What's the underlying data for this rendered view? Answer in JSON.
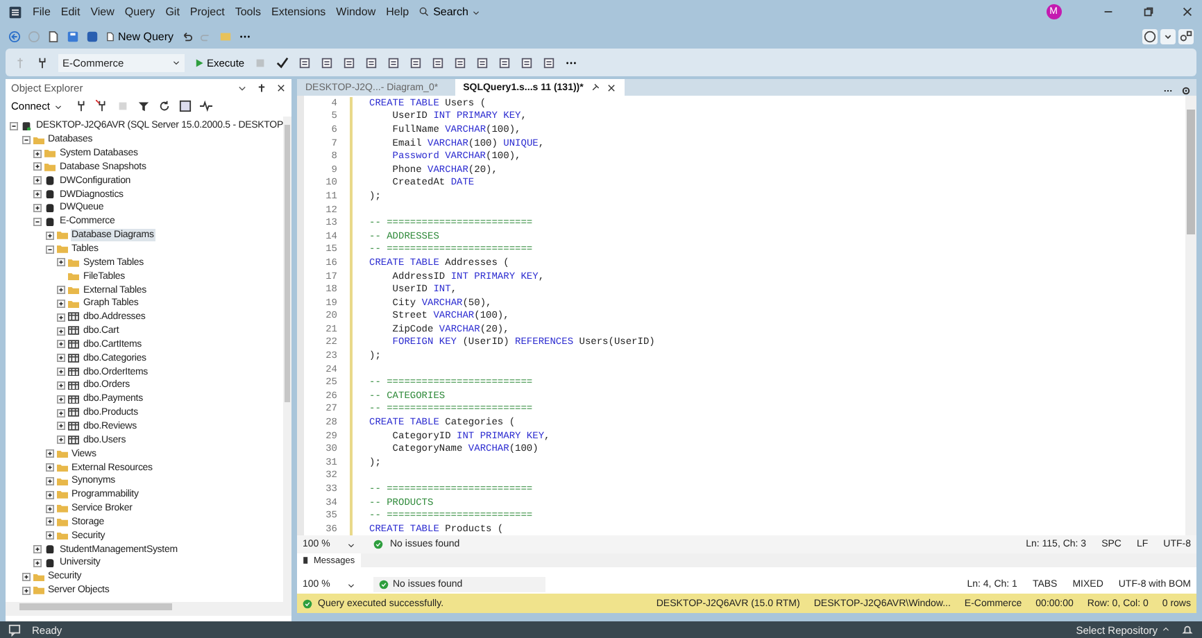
{
  "menu": {
    "items": [
      "File",
      "Edit",
      "View",
      "Query",
      "Git",
      "Project",
      "Tools",
      "Extensions",
      "Window",
      "Help"
    ],
    "search": "Search",
    "avatar": "M"
  },
  "toolbar": {
    "new_query": "New Query",
    "database": "E-Commerce",
    "execute": "Execute"
  },
  "object_explorer": {
    "title": "Object Explorer",
    "connect": "Connect",
    "tree": [
      {
        "label": "DESKTOP-J2Q6AVR (SQL Server 15.0.2000.5 - DESKTOP",
        "kind": "server",
        "expanded": true,
        "selected": false,
        "children": [
          {
            "label": "Databases",
            "kind": "folder",
            "expanded": true,
            "selected": false,
            "children": [
              {
                "label": "System Databases",
                "kind": "folder",
                "expanded": false,
                "selected": false
              },
              {
                "label": "Database Snapshots",
                "kind": "folder",
                "expanded": false,
                "selected": false
              },
              {
                "label": "DWConfiguration",
                "kind": "db",
                "expanded": false,
                "selected": false
              },
              {
                "label": "DWDiagnostics",
                "kind": "db",
                "expanded": false,
                "selected": false
              },
              {
                "label": "DWQueue",
                "kind": "db",
                "expanded": false,
                "selected": false
              },
              {
                "label": "E-Commerce",
                "kind": "db",
                "expanded": true,
                "selected": false,
                "children": [
                  {
                    "label": "Database Diagrams",
                    "kind": "folder",
                    "expanded": false,
                    "selected": true
                  },
                  {
                    "label": "Tables",
                    "kind": "folder",
                    "expanded": true,
                    "selected": false,
                    "children": [
                      {
                        "label": "System Tables",
                        "kind": "folder",
                        "expanded": false,
                        "selected": false
                      },
                      {
                        "label": "FileTables",
                        "kind": "folder",
                        "selected": false
                      },
                      {
                        "label": "External Tables",
                        "kind": "folder",
                        "expanded": false,
                        "selected": false
                      },
                      {
                        "label": "Graph Tables",
                        "kind": "folder",
                        "expanded": false,
                        "selected": false
                      },
                      {
                        "label": "dbo.Addresses",
                        "kind": "table",
                        "expanded": false,
                        "selected": false
                      },
                      {
                        "label": "dbo.Cart",
                        "kind": "table",
                        "expanded": false,
                        "selected": false
                      },
                      {
                        "label": "dbo.CartItems",
                        "kind": "table",
                        "expanded": false,
                        "selected": false
                      },
                      {
                        "label": "dbo.Categories",
                        "kind": "table",
                        "expanded": false,
                        "selected": false
                      },
                      {
                        "label": "dbo.OrderItems",
                        "kind": "table",
                        "expanded": false,
                        "selected": false
                      },
                      {
                        "label": "dbo.Orders",
                        "kind": "table",
                        "expanded": false,
                        "selected": false
                      },
                      {
                        "label": "dbo.Payments",
                        "kind": "table",
                        "expanded": false,
                        "selected": false
                      },
                      {
                        "label": "dbo.Products",
                        "kind": "table",
                        "expanded": false,
                        "selected": false
                      },
                      {
                        "label": "dbo.Reviews",
                        "kind": "table",
                        "expanded": false,
                        "selected": false
                      },
                      {
                        "label": "dbo.Users",
                        "kind": "table",
                        "expanded": false,
                        "selected": false
                      }
                    ]
                  },
                  {
                    "label": "Views",
                    "kind": "folder",
                    "expanded": false,
                    "selected": false
                  },
                  {
                    "label": "External Resources",
                    "kind": "folder",
                    "expanded": false,
                    "selected": false
                  },
                  {
                    "label": "Synonyms",
                    "kind": "folder",
                    "expanded": false,
                    "selected": false
                  },
                  {
                    "label": "Programmability",
                    "kind": "folder",
                    "expanded": false,
                    "selected": false
                  },
                  {
                    "label": "Service Broker",
                    "kind": "folder",
                    "expanded": false,
                    "selected": false
                  },
                  {
                    "label": "Storage",
                    "kind": "folder",
                    "expanded": false,
                    "selected": false
                  },
                  {
                    "label": "Security",
                    "kind": "folder",
                    "expanded": false,
                    "selected": false
                  }
                ]
              },
              {
                "label": "StudentManagementSystem",
                "kind": "db",
                "expanded": false,
                "selected": false
              },
              {
                "label": "University",
                "kind": "db",
                "expanded": false,
                "selected": false
              }
            ]
          },
          {
            "label": "Security",
            "kind": "folder",
            "expanded": false,
            "selected": false
          },
          {
            "label": "Server Objects",
            "kind": "folder",
            "expanded": false,
            "selected": false
          }
        ]
      }
    ]
  },
  "tabs": [
    {
      "label": "DESKTOP-J2Q...- Diagram_0*",
      "selected": false
    },
    {
      "label": "SQLQuery1.s...s 11 (131))*",
      "selected": true
    }
  ],
  "code": [
    {
      "num": "4",
      "tokens": [
        {
          "kind": "kw",
          "t": "CREATE TABLE"
        },
        {
          "kind": "id",
          "t": " Users ("
        }
      ]
    },
    {
      "num": "5",
      "tokens": [
        {
          "kind": "id",
          "t": "    UserID "
        },
        {
          "kind": "kw",
          "t": "INT PRIMARY KEY"
        },
        {
          "kind": "id",
          "t": ","
        }
      ]
    },
    {
      "num": "6",
      "tokens": [
        {
          "kind": "id",
          "t": "    FullName "
        },
        {
          "kind": "kw",
          "t": "VARCHAR"
        },
        {
          "kind": "id",
          "t": "(100),"
        }
      ]
    },
    {
      "num": "7",
      "tokens": [
        {
          "kind": "id",
          "t": "    Email "
        },
        {
          "kind": "kw",
          "t": "VARCHAR"
        },
        {
          "kind": "id",
          "t": "(100) "
        },
        {
          "kind": "kw",
          "t": "UNIQUE"
        },
        {
          "kind": "id",
          "t": ","
        }
      ]
    },
    {
      "num": "8",
      "indent": true,
      "tokens": [
        {
          "kind": "kw",
          "t": "Password VARCHAR"
        },
        {
          "kind": "id",
          "t": "(100),"
        }
      ]
    },
    {
      "num": "9",
      "tokens": [
        {
          "kind": "id",
          "t": "    Phone "
        },
        {
          "kind": "kw",
          "t": "VARCHAR"
        },
        {
          "kind": "id",
          "t": "(20),"
        }
      ]
    },
    {
      "num": "10",
      "tokens": [
        {
          "kind": "id",
          "t": "    CreatedAt "
        },
        {
          "kind": "kw",
          "t": "DATE"
        }
      ]
    },
    {
      "num": "11",
      "tokens": [
        {
          "kind": "id",
          "t": ");"
        }
      ]
    },
    {
      "num": "12"
    },
    {
      "num": "13",
      "tokens": [
        {
          "kind": "cm",
          "t": "-- ========================="
        }
      ]
    },
    {
      "num": "14",
      "tokens": [
        {
          "kind": "cm",
          "t": "-- ADDRESSES"
        }
      ]
    },
    {
      "num": "15",
      "tokens": [
        {
          "kind": "cm",
          "t": "-- ========================="
        }
      ]
    },
    {
      "num": "16",
      "tokens": [
        {
          "kind": "kw",
          "t": "CREATE TABLE"
        },
        {
          "kind": "id",
          "t": " Addresses ("
        }
      ]
    },
    {
      "num": "17",
      "tokens": [
        {
          "kind": "id",
          "t": "    AddressID "
        },
        {
          "kind": "kw",
          "t": "INT PRIMARY KEY"
        },
        {
          "kind": "id",
          "t": ","
        }
      ]
    },
    {
      "num": "18",
      "tokens": [
        {
          "kind": "id",
          "t": "    UserID "
        },
        {
          "kind": "kw",
          "t": "INT"
        },
        {
          "kind": "id",
          "t": ","
        }
      ]
    },
    {
      "num": "19",
      "tokens": [
        {
          "kind": "id",
          "t": "    City "
        },
        {
          "kind": "kw",
          "t": "VARCHAR"
        },
        {
          "kind": "id",
          "t": "(50),"
        }
      ]
    },
    {
      "num": "20",
      "tokens": [
        {
          "kind": "id",
          "t": "    Street "
        },
        {
          "kind": "kw",
          "t": "VARCHAR"
        },
        {
          "kind": "id",
          "t": "(100),"
        }
      ]
    },
    {
      "num": "21",
      "tokens": [
        {
          "kind": "id",
          "t": "    ZipCode "
        },
        {
          "kind": "kw",
          "t": "VARCHAR"
        },
        {
          "kind": "id",
          "t": "(20),"
        }
      ]
    },
    {
      "num": "22",
      "indent": true,
      "tokens": [
        {
          "kind": "kw",
          "t": "FOREIGN KEY"
        },
        {
          "kind": "id",
          "t": " (UserID) "
        },
        {
          "kind": "kw",
          "t": "REFERENCES"
        },
        {
          "kind": "id",
          "t": " Users(UserID)"
        }
      ]
    },
    {
      "num": "23",
      "tokens": [
        {
          "kind": "id",
          "t": ");"
        }
      ]
    },
    {
      "num": "24"
    },
    {
      "num": "25",
      "tokens": [
        {
          "kind": "cm",
          "t": "-- ========================="
        }
      ]
    },
    {
      "num": "26",
      "tokens": [
        {
          "kind": "cm",
          "t": "-- CATEGORIES"
        }
      ]
    },
    {
      "num": "27",
      "tokens": [
        {
          "kind": "cm",
          "t": "-- ========================="
        }
      ]
    },
    {
      "num": "28",
      "tokens": [
        {
          "kind": "kw",
          "t": "CREATE TABLE"
        },
        {
          "kind": "id",
          "t": " Categories ("
        }
      ]
    },
    {
      "num": "29",
      "tokens": [
        {
          "kind": "id",
          "t": "    CategoryID "
        },
        {
          "kind": "kw",
          "t": "INT PRIMARY KEY"
        },
        {
          "kind": "id",
          "t": ","
        }
      ]
    },
    {
      "num": "30",
      "tokens": [
        {
          "kind": "id",
          "t": "    CategoryName "
        },
        {
          "kind": "kw",
          "t": "VARCHAR"
        },
        {
          "kind": "id",
          "t": "(100)"
        }
      ]
    },
    {
      "num": "31",
      "tokens": [
        {
          "kind": "id",
          "t": ");"
        }
      ]
    },
    {
      "num": "32"
    },
    {
      "num": "33",
      "tokens": [
        {
          "kind": "cm",
          "t": "-- ========================="
        }
      ]
    },
    {
      "num": "34",
      "tokens": [
        {
          "kind": "cm",
          "t": "-- PRODUCTS"
        }
      ]
    },
    {
      "num": "35",
      "tokens": [
        {
          "kind": "cm",
          "t": "-- ========================="
        }
      ]
    },
    {
      "num": "36",
      "tokens": [
        {
          "kind": "kw",
          "t": "CREATE TABLE"
        },
        {
          "kind": "id",
          "t": " Products ("
        }
      ]
    }
  ],
  "editor_bar": {
    "zoom": "100 %",
    "issues": "No issues found",
    "right": [
      "Ln: 115, Ch: 3",
      "SPC",
      "LF",
      "UTF-8"
    ]
  },
  "messages_tab": "Messages",
  "messages_bar": {
    "zoom": "100 %",
    "issues": "No issues found",
    "right": [
      "Ln: 4, Ch: 1",
      "TABS",
      "MIXED",
      "UTF-8 with BOM"
    ]
  },
  "query_status": {
    "message": "Query executed successfully.",
    "items": [
      "DESKTOP-J2Q6AVR (15.0 RTM)",
      "DESKTOP-J2Q6AVR\\Window...",
      "E-Commerce",
      "00:00:00",
      "Row: 0, Col: 0",
      "0 rows"
    ]
  },
  "status_bar": {
    "text": "Ready",
    "repository": "Select Repository"
  }
}
